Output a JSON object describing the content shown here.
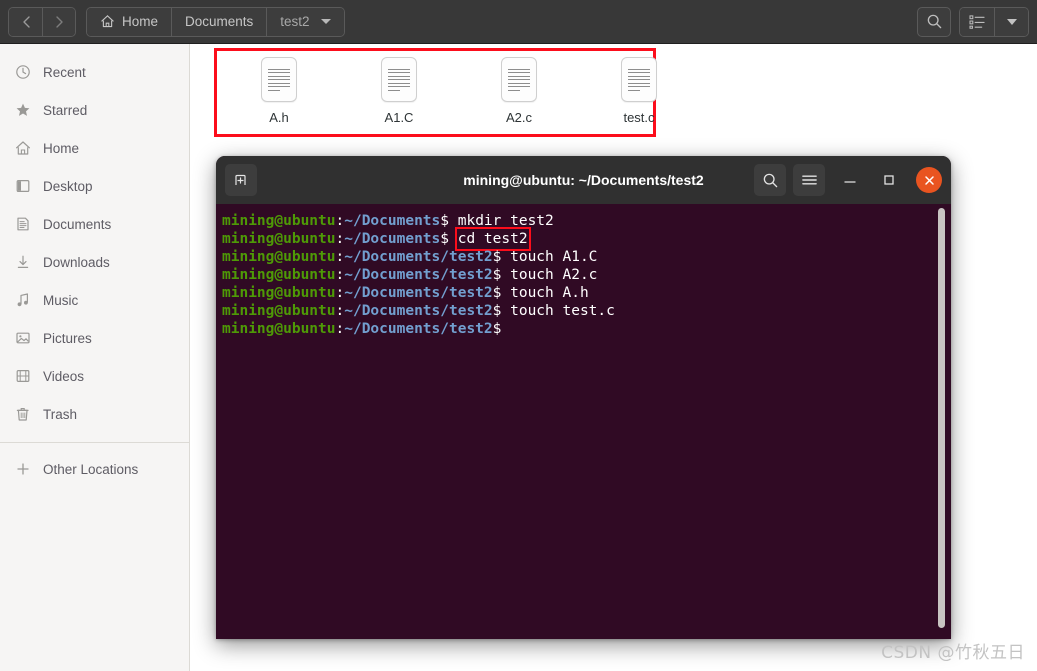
{
  "header": {
    "nav": {
      "back_label": "Back",
      "forward_label": "Forward"
    },
    "breadcrumbs": [
      {
        "label": "Home",
        "icon": "home-icon"
      },
      {
        "label": "Documents",
        "icon": ""
      },
      {
        "label": "test2",
        "icon": ""
      }
    ],
    "search_label": "Search",
    "view_list_label": "List view",
    "view_options_label": "View options"
  },
  "sidebar": {
    "items": [
      {
        "label": "Recent",
        "icon": "clock-icon"
      },
      {
        "label": "Starred",
        "icon": "star-icon"
      },
      {
        "label": "Home",
        "icon": "home-icon"
      },
      {
        "label": "Desktop",
        "icon": "desktop-icon"
      },
      {
        "label": "Documents",
        "icon": "document-icon"
      },
      {
        "label": "Downloads",
        "icon": "download-icon"
      },
      {
        "label": "Music",
        "icon": "music-icon"
      },
      {
        "label": "Pictures",
        "icon": "picture-icon"
      },
      {
        "label": "Videos",
        "icon": "video-icon"
      },
      {
        "label": "Trash",
        "icon": "trash-icon"
      }
    ],
    "other_locations": {
      "label": "Other Locations",
      "icon": "plus-icon"
    }
  },
  "files": [
    {
      "name": "A.h",
      "icon": "document-file-icon"
    },
    {
      "name": "A1.C",
      "icon": "document-file-icon"
    },
    {
      "name": "A2.c",
      "icon": "document-file-icon"
    },
    {
      "name": "test.c",
      "icon": "document-file-icon"
    }
  ],
  "terminal": {
    "title": "mining@ubuntu: ~/Documents/test2",
    "new_tab_label": "New Tab",
    "search_label": "Search",
    "menu_label": "Menu",
    "minimize_label": "Minimize",
    "maximize_label": "Maximize",
    "close_label": "Close",
    "lines": [
      {
        "user": "mining@ubuntu",
        "path": "~/Documents",
        "cmd": "mkdir test2",
        "highlight": false
      },
      {
        "user": "mining@ubuntu",
        "path": "~/Documents",
        "cmd": "cd test2",
        "highlight": true
      },
      {
        "user": "mining@ubuntu",
        "path": "~/Documents/test2",
        "cmd": "touch A1.C",
        "highlight": false
      },
      {
        "user": "mining@ubuntu",
        "path": "~/Documents/test2",
        "cmd": "touch A2.c",
        "highlight": false
      },
      {
        "user": "mining@ubuntu",
        "path": "~/Documents/test2",
        "cmd": "touch A.h",
        "highlight": false
      },
      {
        "user": "mining@ubuntu",
        "path": "~/Documents/test2",
        "cmd": "touch test.c",
        "highlight": false
      },
      {
        "user": "mining@ubuntu",
        "path": "~/Documents/test2",
        "cmd": "",
        "highlight": false
      }
    ]
  },
  "watermark": {
    "text": "CSDN @竹秋五日"
  },
  "colors": {
    "header_bg": "#383838",
    "sidebar_bg": "#f6f5f4",
    "terminal_bg": "#300a24",
    "terminal_titlebar_bg": "#303030",
    "prompt_user": "#4e9a06",
    "prompt_path": "#729fcf",
    "highlight_red": "#fc0d1b",
    "close_orange": "#e95420"
  }
}
